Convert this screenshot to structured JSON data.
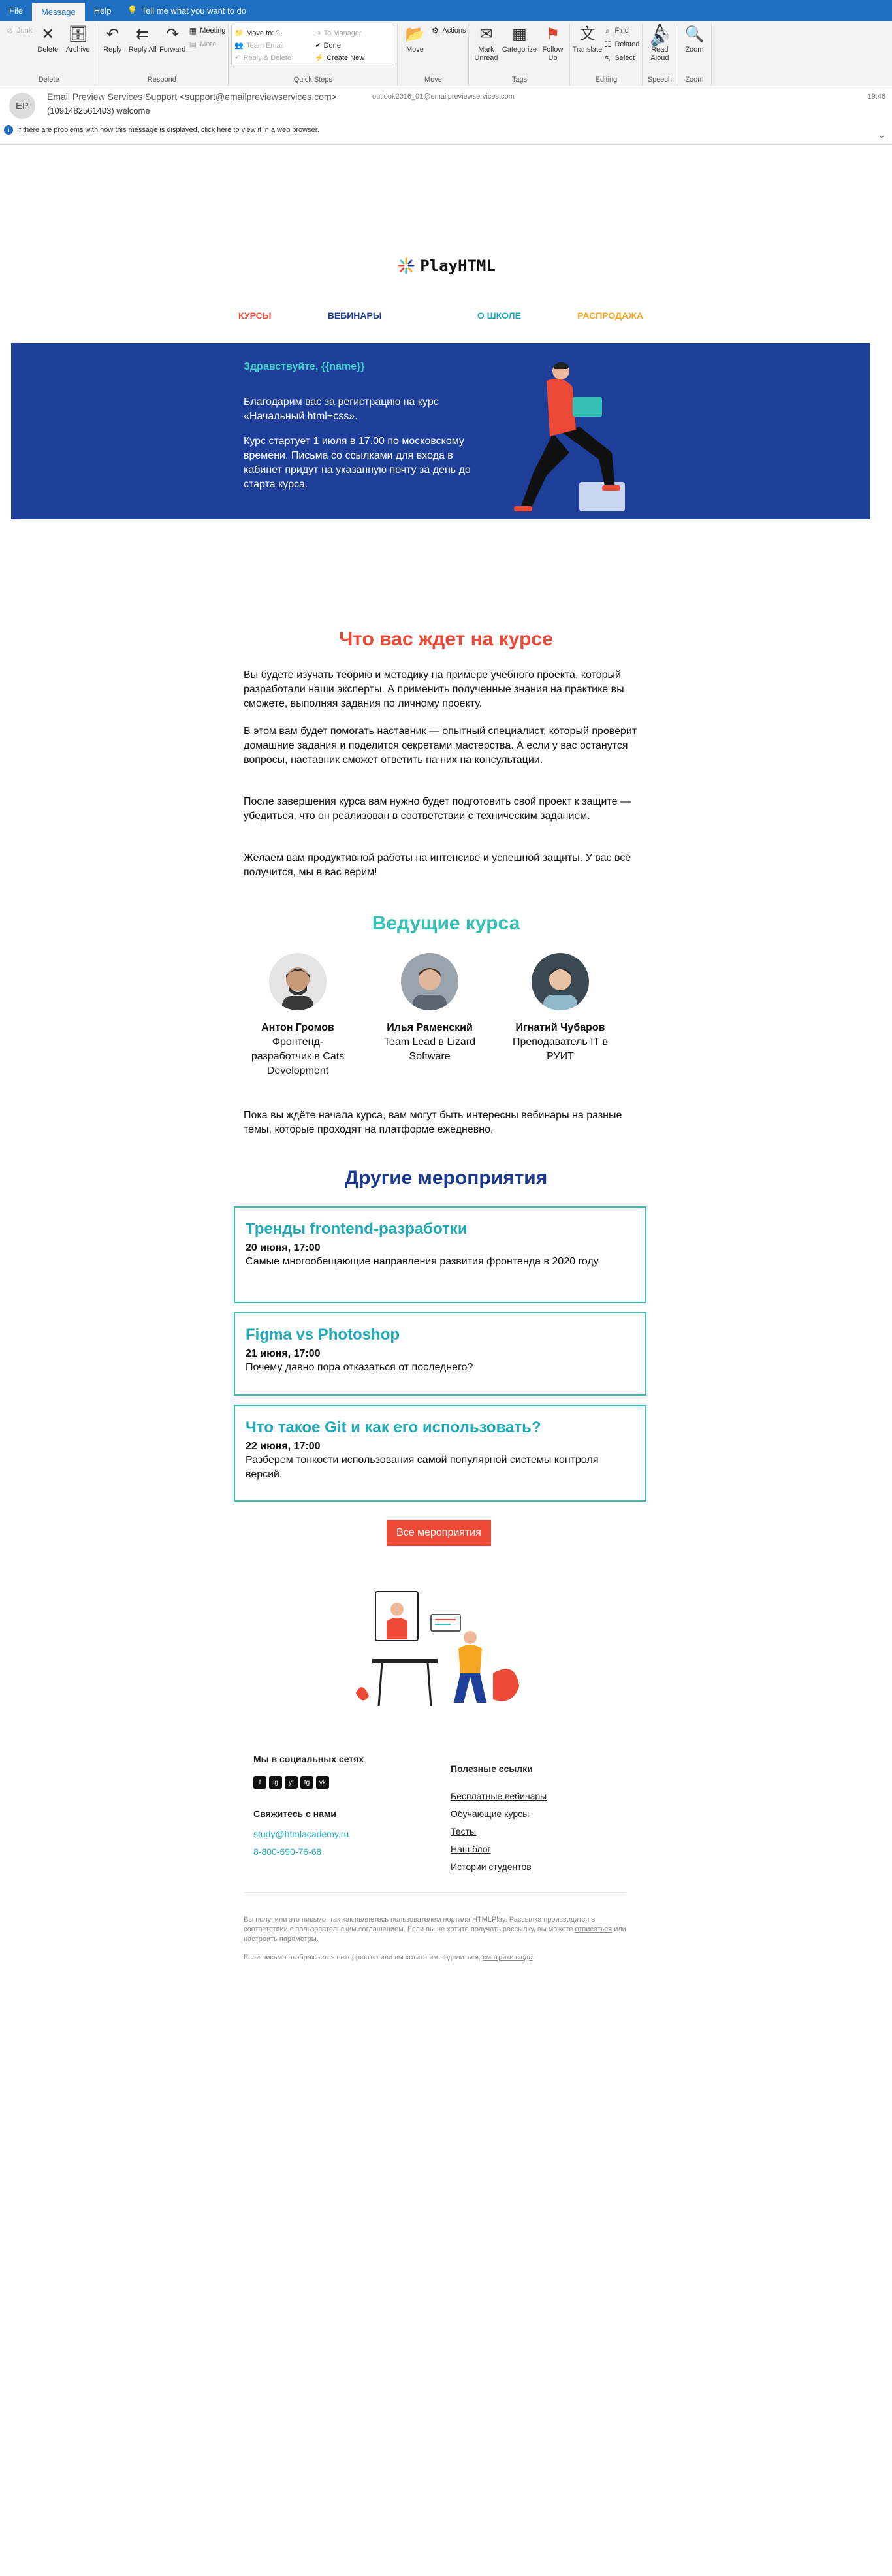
{
  "ribbon": {
    "tabs": [
      "File",
      "Message",
      "Help"
    ],
    "tell_me": "Tell me what you want to do",
    "delete_group": {
      "junk": "Junk",
      "delete": "Delete",
      "archive": "Archive",
      "label": "Delete"
    },
    "respond_group": {
      "reply": "Reply",
      "reply_all": "Reply All",
      "forward": "Forward",
      "meeting": "Meeting",
      "more": "More",
      "label": "Respond"
    },
    "quick_steps": {
      "items": [
        "Move to: ?",
        "Team Email",
        "Reply & Delete",
        "To Manager",
        "Done",
        "Create New"
      ],
      "label": "Quick Steps"
    },
    "move_group": {
      "move": "Move",
      "actions": "Actions",
      "label": "Move"
    },
    "tags_group": {
      "mark_unread": "Mark Unread",
      "categorize": "Categorize",
      "follow_up": "Follow Up",
      "label": "Tags"
    },
    "editing_group": {
      "translate": "Translate",
      "find": "Find",
      "related": "Related",
      "select": "Select",
      "label": "Editing"
    },
    "speech_group": {
      "read_aloud": "Read Aloud",
      "label": "Speech"
    },
    "zoom_group": {
      "zoom": "Zoom",
      "label": "Zoom"
    }
  },
  "message": {
    "avatar": "EP",
    "sender": "Email Preview Services Support <support@emailpreviewservices.com>",
    "to": "outlook2016_01@emailpreviewservices.com",
    "time": "19:46",
    "subject": "(1091482561403) welcome",
    "info": "If there are problems with how this message is displayed, click here to view it in a web browser."
  },
  "email": {
    "logo": "PlayHTML",
    "nav": [
      "КУРСЫ",
      "ВЕБИНАРЫ",
      "О ШКОЛЕ",
      "РАСПРОДАЖА"
    ],
    "hero": {
      "greeting": "Здравствуйте, {{name}}",
      "p1": "Благодарим вас за регистрацию на курс «Начальный html+css».",
      "p2": "Курс стартует 1 июля в 17.00 по московскому времени. Письма со ссылками для входа в кабинет придут на указанную почту за день до старта курса."
    },
    "what_title": "Что вас ждет на курсе",
    "paragraphs": [
      "Вы будете изучать теорию и методику на примере учебного проекта, который разработали наши эксперты. А применить полученные знания на практике вы сможете, выполняя задания по личному проекту.",
      "В этом вам будет помогать наставник — опытный специалист, который проверит домашние задания и поделится секретами мастерства. А если у вас останутся вопросы, наставник сможет ответить на них на консультации.",
      "После завершения курса вам нужно будет подготовить свой проект к защите — убедиться, что он реализован в соответствии с техническим заданием.",
      "Желаем вам продуктивной работы на интенсиве и успешной защиты. У вас всё получится, мы в вас верим!"
    ],
    "mentors_title": "Ведущие курса",
    "mentors": [
      {
        "name": "Антон Громов",
        "role": "Фронтенд-разработчик в Cats Development"
      },
      {
        "name": "Илья Раменский",
        "role": "Team Lead в Lizard Software"
      },
      {
        "name": "Игнатий Чубаров",
        "role": "Преподаватель IT в РУИТ"
      }
    ],
    "webinars_note": "Пока вы ждёте начала курса, вам могут быть интересны вебинары на разные темы, которые проходят на платформе ежедневно.",
    "events_title": "Другие мероприятия",
    "events": [
      {
        "title": "Тренды frontend-разработки",
        "date": "20 июня, 17:00",
        "text": "Самые многообещающие направления развития фронтенда в 2020 году"
      },
      {
        "title": "Figma vs Photoshop",
        "date": "21 июня, 17:00",
        "text": "Почему давно пора отказаться от последнего?"
      },
      {
        "title": "Что такое Git и как его использовать?",
        "date": "22 июня, 17:00",
        "text": "Разберем тонкости использования самой популярной системы контроля версий."
      }
    ],
    "all_events_button": "Все мероприятия",
    "footer": {
      "social_title": "Мы в социальных сетях",
      "social_icons": [
        "f",
        "ig",
        "yt",
        "tg",
        "vk"
      ],
      "contact_title": "Свяжитесь с нами",
      "email": "study@htmlacademy.ru",
      "phone": "8-800-690-76-68",
      "links_title": "Полезные ссылки",
      "links": [
        "Бесплатные вебинары",
        "Обучающие курсы",
        "Тесты",
        "Наш блог",
        "Истории студентов"
      ]
    },
    "legal": {
      "p1_text": "Вы получили это письмо, так как являетесь пользователем портала HTMLPlay. Рассылка производится в соответствии с пользовательским соглашением. Если вы не хотите получать рассылку, вы можете",
      "unsubscribe": "отписаться",
      "or": "или",
      "settings": "настроить параметры",
      "p2_text": "Если письмо отображается некорректно или вы хотите им поделиться,",
      "view_here": "смотрите сюда"
    }
  },
  "colors": {
    "ribbon_blue": "#1e6fbf",
    "hero_blue": "#1d3e99",
    "accent_red": "#ec4a37",
    "accent_teal": "#34c0b5",
    "nav_orange": "#f5a623",
    "title_navy": "#1b3a8f"
  }
}
